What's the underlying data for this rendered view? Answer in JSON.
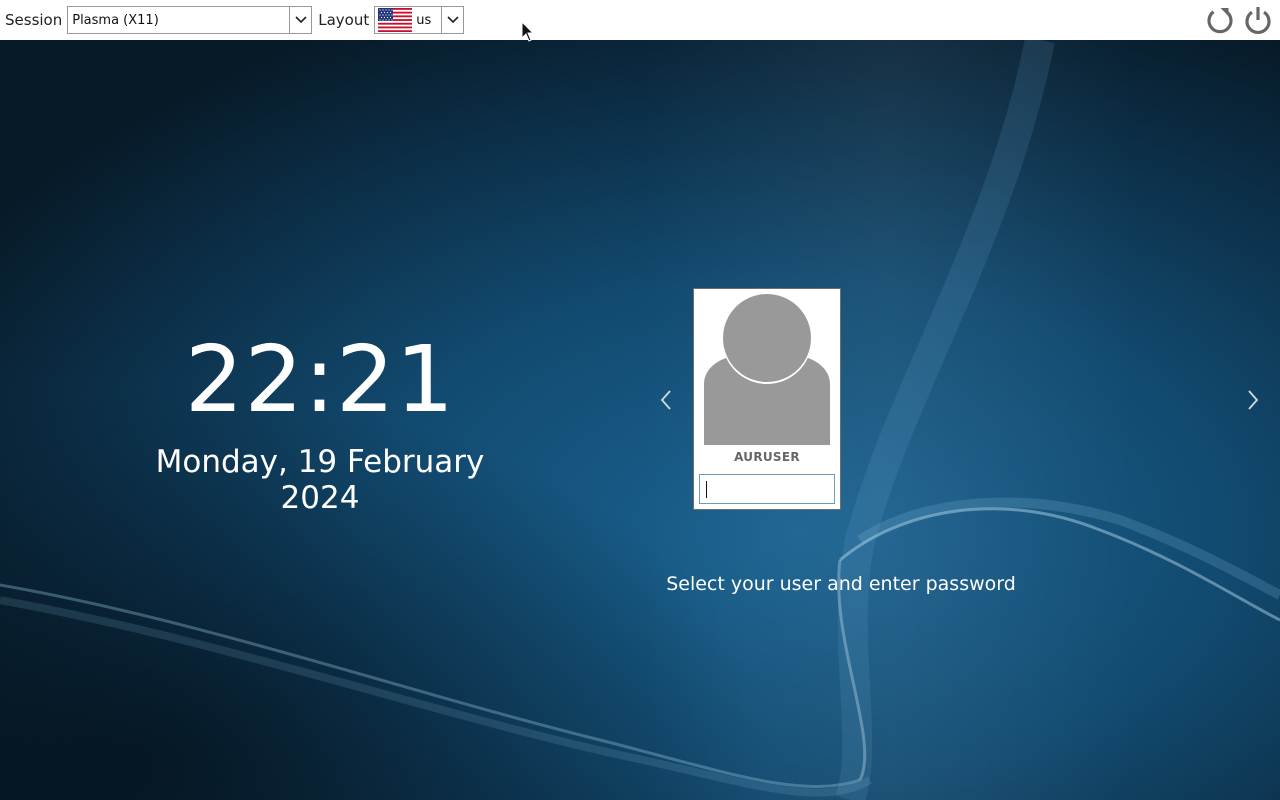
{
  "topbar": {
    "session_label": "Session",
    "session_value": "Plasma (X11)",
    "layout_label": "Layout",
    "layout_value": "us",
    "layout_flag_icon": "us-flag-icon",
    "reboot_icon": "reboot-icon",
    "shutdown_icon": "power-icon"
  },
  "clock": {
    "time": "22:21",
    "date": "Monday, 19 February 2024"
  },
  "user": {
    "name": "AURUSER",
    "password_value": ""
  },
  "hint": "Select your user and enter password",
  "colors": {
    "bg_dark": "#0a2233",
    "bg_mid": "#14547c",
    "accent_light": "#4f9fd0",
    "avatar_gray": "#999999",
    "icon_gray": "#666666"
  }
}
